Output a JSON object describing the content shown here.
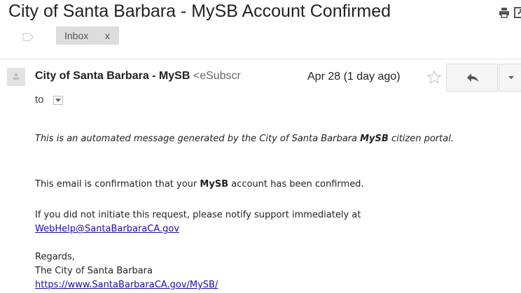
{
  "email": {
    "subject": "City of Santa Barbara - MySB Account Confirmed",
    "label": "Inbox",
    "label_remove": "x",
    "sender_name": "City of Santa Barbara - MySB",
    "sender_email": "<eSubscr",
    "date": "Apr 28 (1 day ago)",
    "to": "to"
  },
  "body": {
    "p1_pre": "This is an automated message generated by the City of Santa Barbara ",
    "p1_bold": "MySB",
    "p1_post": " citizen portal.",
    "p2_pre": "This email is confirmation that your ",
    "p2_bold": "MySB",
    "p2_post": " account has been confirmed.",
    "p3_text": "If you did not initiate this request, please notify support immediately at",
    "p3_link": "WebHelp@SantaBarbaraCA.gov",
    "regards": "Regards,",
    "signature": "The City of Santa Barbara",
    "site_link": "https://www.SantaBarbaraCA.gov/MySB/"
  },
  "icons": {
    "print": "print-icon",
    "new_window": "new-window-icon",
    "label": "label-icon",
    "star": "star-icon",
    "reply": "reply-icon",
    "more": "chevron-down-icon"
  }
}
